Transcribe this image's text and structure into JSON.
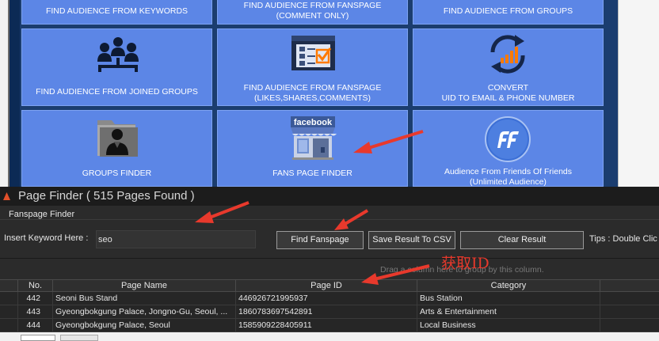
{
  "tiles": [
    {
      "label": "FIND AUDIENCE FROM KEYWORDS",
      "icon": "none"
    },
    {
      "label": "FIND AUDIENCE FROM FANSPAGE\n(COMMENT ONLY)",
      "icon": "none"
    },
    {
      "label": "FIND AUDIENCE FROM GROUPS",
      "icon": "none"
    },
    {
      "label": "FIND AUDIENCE FROM JOINED GROUPS",
      "icon": "group-people-icon"
    },
    {
      "label": "FIND AUDIENCE FROM FANSPAGE\n(LIKES,SHARES,COMMENTS)",
      "icon": "checklist-icon"
    },
    {
      "label": "CONVERT\nUID TO EMAIL & PHONE NUMBER",
      "icon": "refresh-chart-icon"
    },
    {
      "label": "GROUPS FINDER",
      "icon": "user-folder-icon"
    },
    {
      "label": "FANS PAGE FINDER",
      "icon": "facebook-store-icon"
    },
    {
      "label": "Audience From Friends Of Friends\n(Unlimited Audience)",
      "icon": "ff-logo-icon"
    }
  ],
  "tile_badge_text": "facebook",
  "finder": {
    "title": "Page Finder ( 515 Pages Found )",
    "group_label": "Fanspage Finder",
    "keyword_label": "Insert Keyword Here :",
    "keyword_value": "seo",
    "find_button": "Find Fanspage",
    "save_button": "Save Result To CSV",
    "clear_button": "Clear Result",
    "tips": "Tips : Double Clic",
    "group_hint": "Drag a column here to group by this column."
  },
  "table": {
    "columns": [
      "No.",
      "Page Name",
      "Page ID",
      "Category"
    ],
    "rows": [
      {
        "no": "442",
        "name": "Seoni Bus Stand",
        "id": "446926721995937",
        "category": "Bus Station"
      },
      {
        "no": "443",
        "name": "Gyeongbokgung Palace, Jongno-Gu, Seoul, ...",
        "id": "1860783697542891",
        "category": "Arts & Entertainment"
      },
      {
        "no": "444",
        "name": "Gyeongbokgung Palace, Seoul",
        "id": "1585909228405911",
        "category": "Local Business"
      }
    ]
  },
  "annotation": {
    "text": "获取ID",
    "color": "#e8392c"
  },
  "colors": {
    "tile": "#5c86e6",
    "tile_border": "#7ea3f2",
    "panel": "#2b2b2b",
    "accent_red": "#e8392c"
  }
}
